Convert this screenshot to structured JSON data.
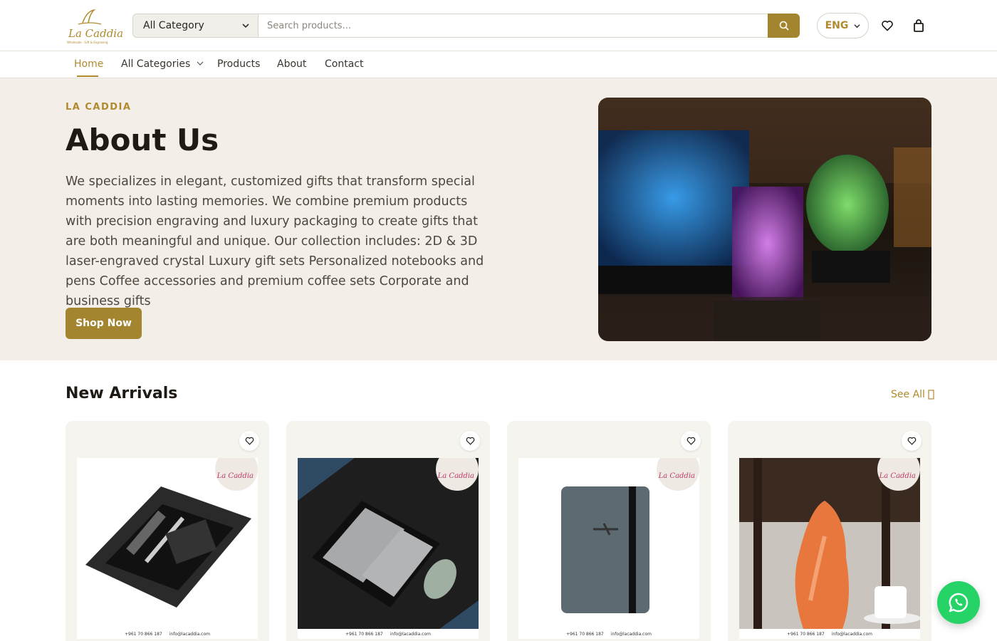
{
  "brand": {
    "name": "La Caddia",
    "tagline": "Wholesale · Gift & Engraving"
  },
  "search": {
    "category": "All Category",
    "placeholder": "Search products..."
  },
  "header": {
    "language": "ENG"
  },
  "nav": {
    "items": [
      "Home",
      "All Categories",
      "Products",
      "About",
      "Contact"
    ],
    "active": "Home"
  },
  "hero": {
    "eyebrow": "LA CADDIA",
    "title": "About Us",
    "text": "We specializes in elegant, customized gifts that transform special moments into lasting memories. We combine premium products with precision engraving and luxury packaging to create gifts that are both meaningful and unique. Our collection includes: 2D & 3D laser-engraved crystal Luxury gift sets Personalized notebooks and pens Coffee accessories and premium coffee sets Corporate and business gifts",
    "button": "Shop Now"
  },
  "arrivals": {
    "title": "New Arrivals",
    "see_all": "See All",
    "products": [
      {
        "image": "keychain-pen-card-gift-set"
      },
      {
        "image": "passport-travel-wallet-set"
      },
      {
        "image": "passport-cover-grey"
      },
      {
        "image": "himalayan-salt-lamp"
      }
    ],
    "card_logo": "La Caddia",
    "card_phone": "+961 70 866 187",
    "card_email": "info@lacaddia.com"
  },
  "colors": {
    "accent": "#a4852f",
    "hero_bg": "#f3efe8",
    "whatsapp": "#25d366"
  }
}
